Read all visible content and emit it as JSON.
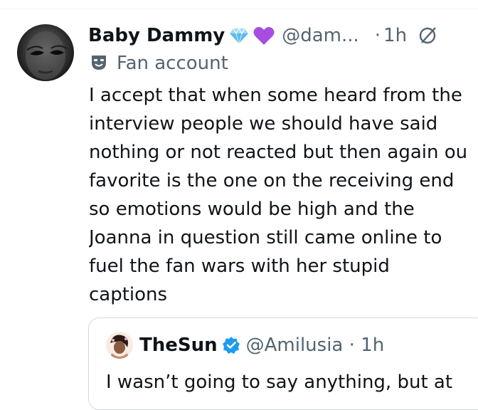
{
  "tweet": {
    "display_name": "Baby Dammy",
    "name_emojis": [
      "gem-emoji",
      "purple-heart-emoji"
    ],
    "handle": "@dam...",
    "separator": "·",
    "time": "1h",
    "label_icon": "theater-masks-icon",
    "label": "Fan account",
    "text_lines": [
      "I accept that when some heard from the",
      "interview people we should have said",
      "nothing or not reacted but then again ou",
      "favorite is the one on the receiving end",
      "so emotions would be high and the",
      "Joanna in question still came online to",
      "fuel the fan wars with her stupid",
      "captions"
    ]
  },
  "quote": {
    "display_name": "TheSun",
    "verified": true,
    "handle": "@Amilusia · 1h",
    "text": "I wasn’t going to say anything, but at"
  },
  "colors": {
    "text_primary": "#0f1419",
    "text_secondary": "#536471",
    "verified_blue": "#1d9bf0",
    "border": "#cfd9de"
  }
}
